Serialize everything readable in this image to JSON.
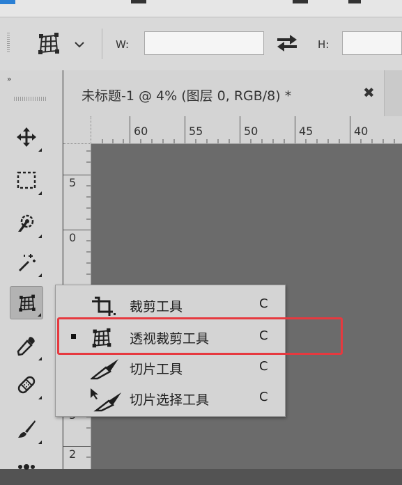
{
  "options_bar": {
    "width_label": "W:",
    "height_label": "H:",
    "width_value": "",
    "height_value": ""
  },
  "toolbox": {
    "collapse_label": "››",
    "tools": [
      {
        "name": "move-icon"
      },
      {
        "name": "rect-marquee-icon"
      },
      {
        "name": "quick-select-icon"
      },
      {
        "name": "magic-wand-icon"
      },
      {
        "name": "perspective-crop-icon",
        "active": true
      },
      {
        "name": "eyedropper-icon"
      },
      {
        "name": "healing-brush-icon"
      },
      {
        "name": "brush-icon"
      },
      {
        "name": "stamp-icon"
      }
    ]
  },
  "document": {
    "tab_title": "未标题-1 @ 4% (图层 0, RGB/8) *",
    "close_glyph": "✖"
  },
  "rulers": {
    "horizontal": [
      "60",
      "55",
      "50",
      "45",
      "40"
    ],
    "vertical": [
      "5",
      "0",
      "5",
      "2"
    ]
  },
  "flyout": {
    "items": [
      {
        "label": "裁剪工具",
        "shortcut": "C",
        "selected": false,
        "icon": "crop-icon"
      },
      {
        "label": "透视裁剪工具",
        "shortcut": "C",
        "selected": true,
        "icon": "perspective-crop-icon"
      },
      {
        "label": "切片工具",
        "shortcut": "C",
        "selected": false,
        "icon": "slice-icon"
      },
      {
        "label": "切片选择工具",
        "shortcut": "C",
        "selected": false,
        "icon": "slice-select-icon"
      }
    ]
  },
  "colors": {
    "highlight": "#e6393f",
    "canvas": "#6b6b6b",
    "panel": "#d4d4d4"
  }
}
